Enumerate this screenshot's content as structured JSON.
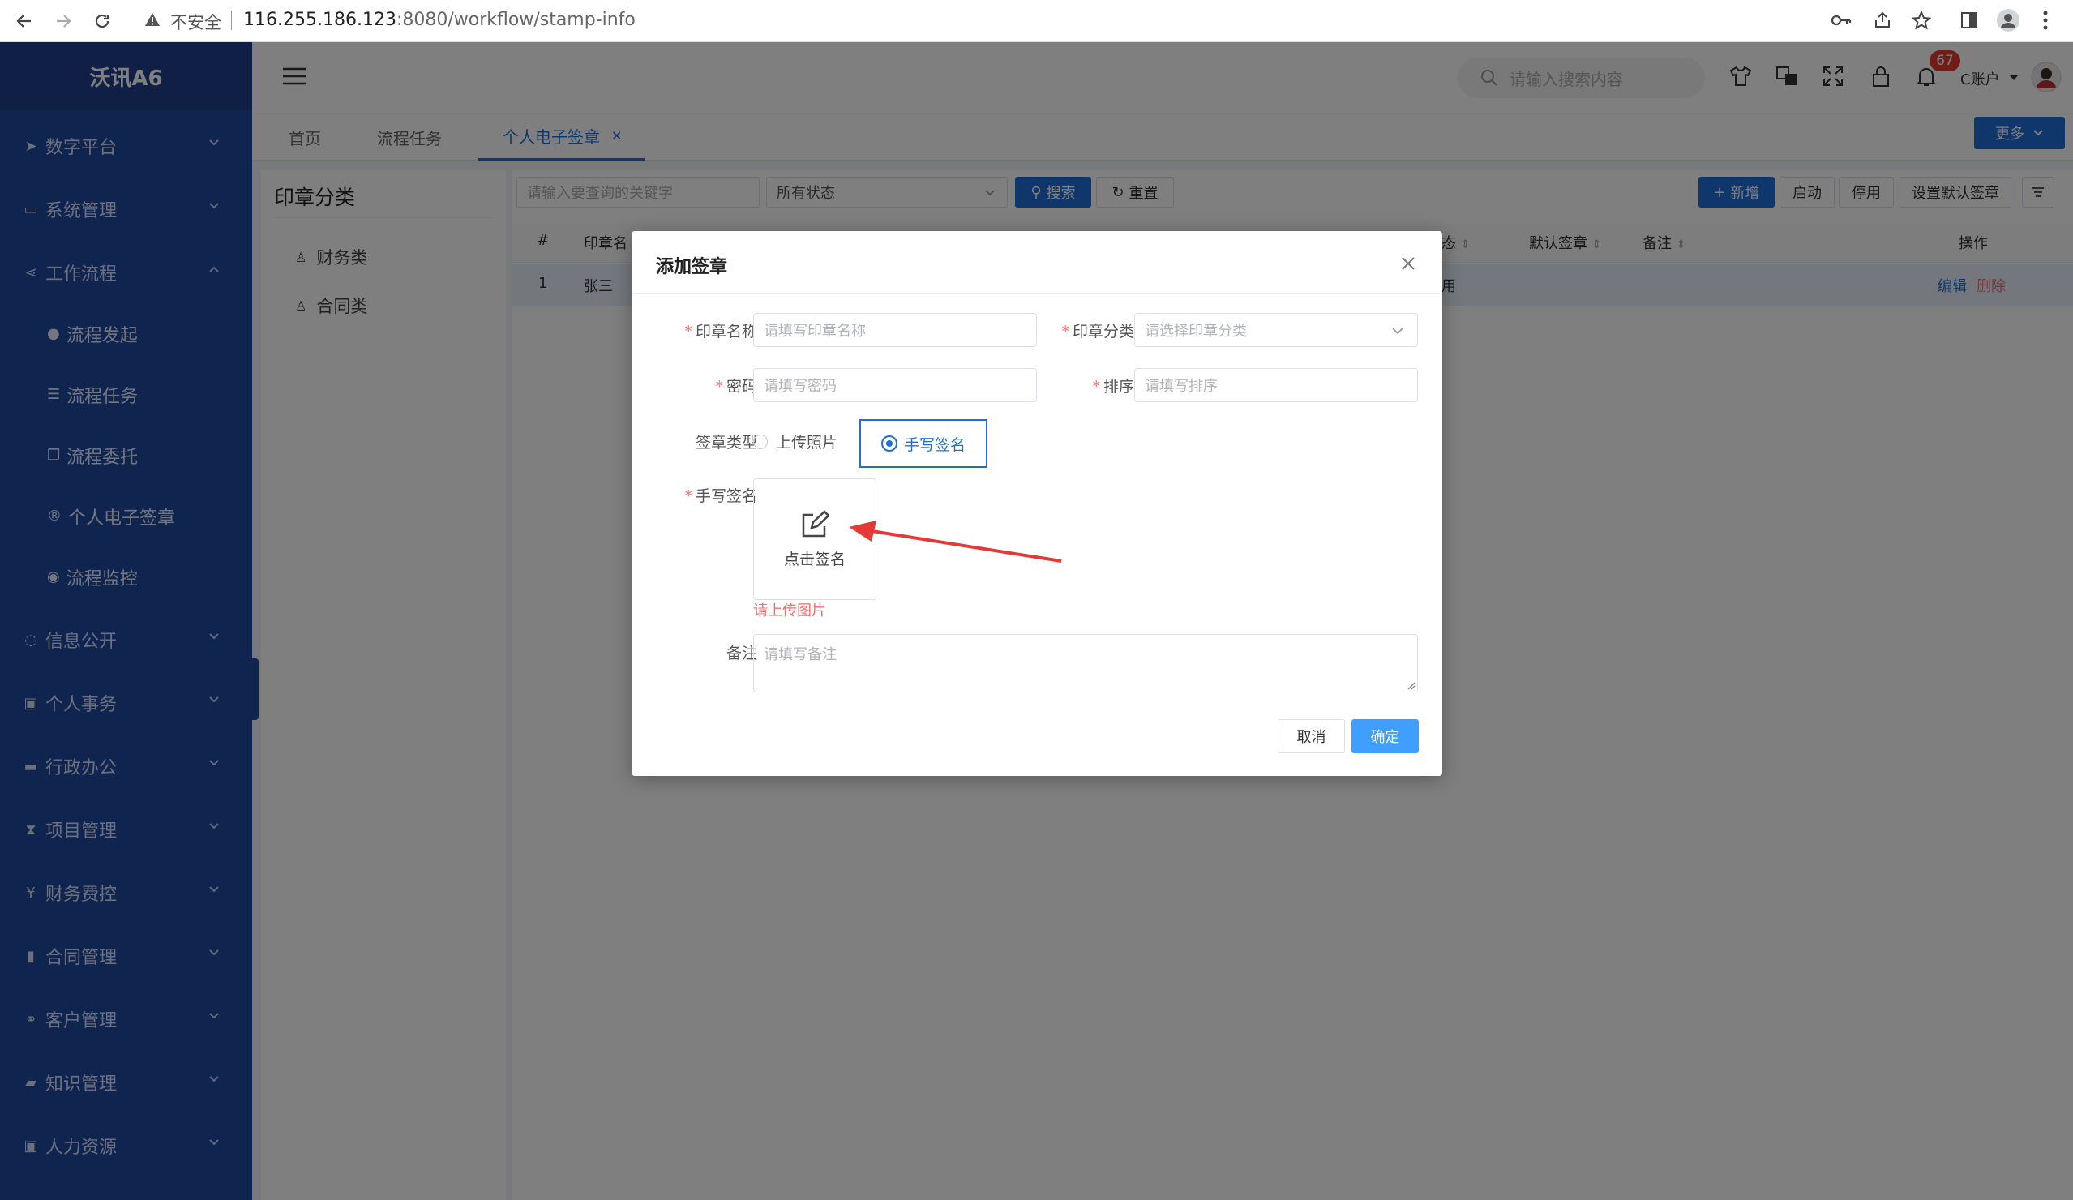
{
  "browser": {
    "security_label": "不安全",
    "url_host": "116.255.186.123",
    "url_rest": ":8080/workflow/stamp-info"
  },
  "app": {
    "logo": "沃讯A6"
  },
  "sidebar": {
    "items": [
      {
        "label": "数字平台",
        "icon": "paper-plane-icon"
      },
      {
        "label": "系统管理",
        "icon": "monitor-icon"
      },
      {
        "label": "工作流程",
        "icon": "share-icon"
      },
      {
        "label": "信息公开",
        "icon": "comment-icon"
      },
      {
        "label": "个人事务",
        "icon": "id-card-icon"
      },
      {
        "label": "行政办公",
        "icon": "briefcase-icon"
      },
      {
        "label": "项目管理",
        "icon": "hourglass-icon"
      },
      {
        "label": "财务费控",
        "icon": "yen-icon"
      },
      {
        "label": "合同管理",
        "icon": "file-icon"
      },
      {
        "label": "客户管理",
        "icon": "handshake-icon"
      },
      {
        "label": "知识管理",
        "icon": "book-icon"
      },
      {
        "label": "人力资源",
        "icon": "user-badge-icon"
      }
    ],
    "sub_items": [
      {
        "label": "流程发起",
        "icon": "play-circle-icon"
      },
      {
        "label": "流程任务",
        "icon": "list-icon"
      },
      {
        "label": "流程委托",
        "icon": "copy-icon"
      },
      {
        "label": "个人电子签章",
        "icon": "registered-icon"
      },
      {
        "label": "流程监控",
        "icon": "eye-icon"
      }
    ]
  },
  "header": {
    "search_placeholder": "请输入搜索内容",
    "badge_count": "67",
    "user_label": "C账户",
    "more_label": "更多"
  },
  "tabs": [
    {
      "label": "首页"
    },
    {
      "label": "流程任务"
    },
    {
      "label": "个人电子签章"
    }
  ],
  "left_panel": {
    "title": "印章分类",
    "items": [
      {
        "label": "财务类"
      },
      {
        "label": "合同类"
      }
    ]
  },
  "toolbar": {
    "keyword_placeholder": "请输入要查询的关键字",
    "status_select": "所有状态",
    "search_label": "搜索",
    "reset_label": "重置",
    "add_label": "新增",
    "enable_label": "启动",
    "disable_label": "停用",
    "default_label": "设置默认签章"
  },
  "table": {
    "headers": [
      "#",
      "印章名",
      "态",
      "默认签章",
      "备注",
      "操作"
    ],
    "row": {
      "index": "1",
      "name": "张三",
      "status": "用",
      "edit": "编辑",
      "delete": "删除"
    }
  },
  "dialog": {
    "title": "添加签章",
    "name_label": "印章名称",
    "name_placeholder": "请填写印章名称",
    "category_label": "印章分类",
    "category_placeholder": "请选择印章分类",
    "password_label": "密码",
    "password_placeholder": "请填写密码",
    "sort_label": "排序",
    "sort_placeholder": "请填写排序",
    "type_label": "签章类型",
    "type_options": [
      "上传照片",
      "手写签名"
    ],
    "handwrite_label": "手写签名",
    "sign_button": "点击签名",
    "upload_error": "请上传图片",
    "remark_label": "备注",
    "remark_placeholder": "请填写备注",
    "cancel_label": "取消",
    "confirm_label": "确定"
  },
  "colors": {
    "sidebar": "#2048a0",
    "primary": "#1e6fd9",
    "error": "#f56c6c",
    "annotation_arrow": "#e53935"
  }
}
